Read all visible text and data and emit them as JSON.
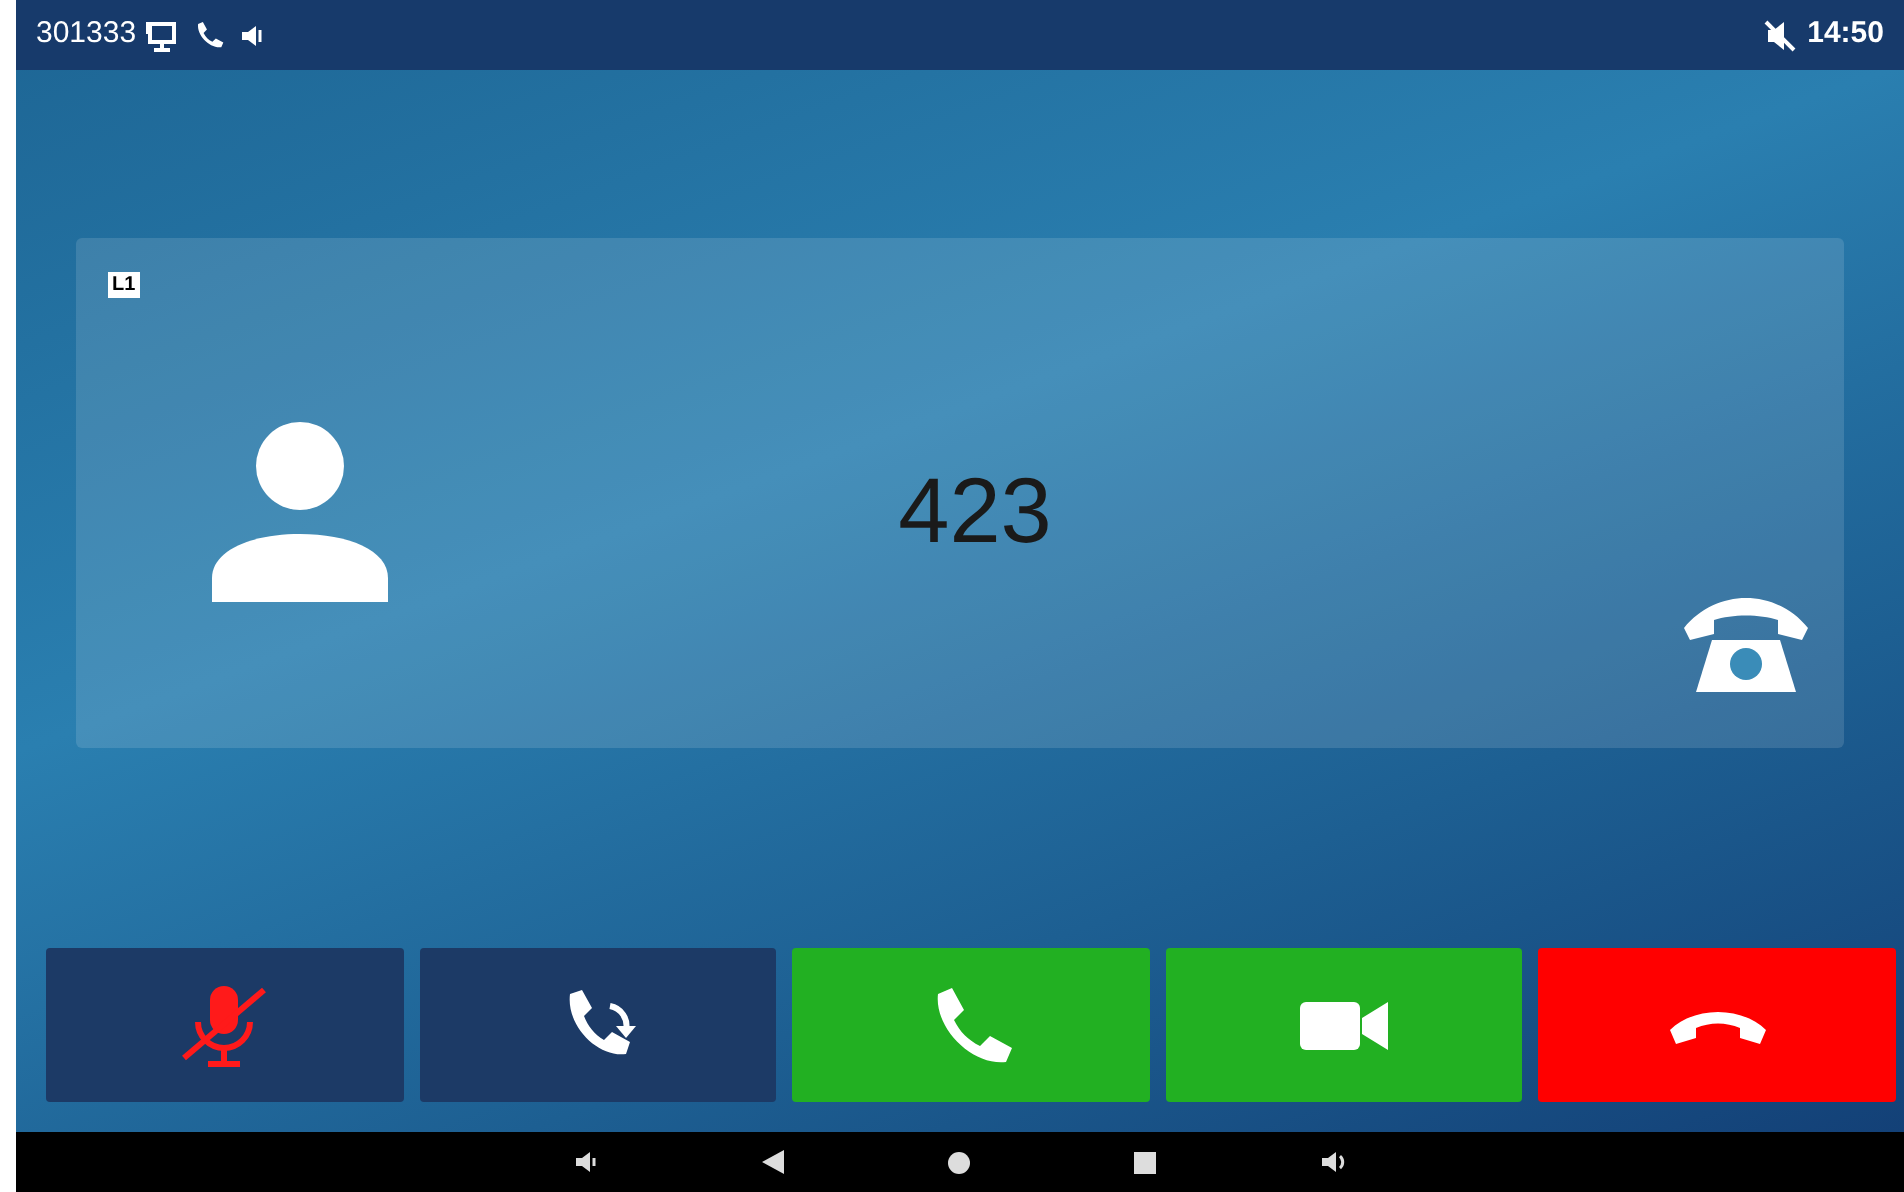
{
  "status_bar": {
    "account": "301333",
    "time": "14:50"
  },
  "call": {
    "line": "L1",
    "number": "423"
  },
  "buttons": [
    {
      "kind": "mute"
    },
    {
      "kind": "transfer"
    },
    {
      "kind": "answer"
    },
    {
      "kind": "video"
    },
    {
      "kind": "hangup"
    }
  ]
}
